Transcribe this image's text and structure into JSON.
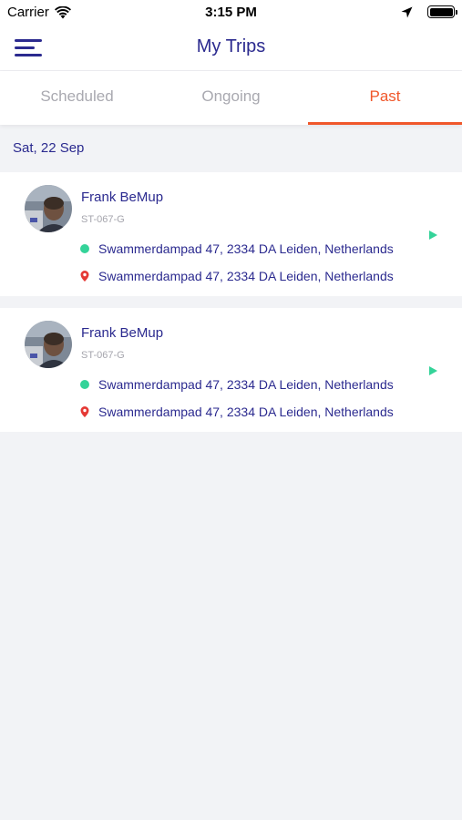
{
  "status_bar": {
    "carrier": "Carrier",
    "time": "3:15 PM",
    "icons": [
      "wifi-icon",
      "location-arrow-icon",
      "battery-icon"
    ]
  },
  "nav": {
    "title": "My Trips",
    "menu_icon": "hamburger-menu-icon"
  },
  "tabs": [
    {
      "label": "Scheduled",
      "active": false
    },
    {
      "label": "Ongoing",
      "active": false
    },
    {
      "label": "Past",
      "active": true
    }
  ],
  "date_header": "Sat, 22 Sep",
  "trips": [
    {
      "driver_name": "Frank BeMup",
      "plate": "ST-067-G",
      "pickup": "Swammerdampad 47, 2334 DA Leiden, Netherlands",
      "dropoff": "Swammerdampad 47, 2334 DA Leiden, Netherlands"
    },
    {
      "driver_name": "Frank BeMup",
      "plate": "ST-067-G",
      "pickup": "Swammerdampad 47, 2334 DA Leiden, Netherlands",
      "dropoff": "Swammerdampad 47, 2334 DA Leiden, Netherlands"
    }
  ],
  "colors": {
    "primary": "#2b2a8f",
    "accent": "#f0572a",
    "pickup_dot": "#34d399",
    "dropoff_pin": "#e53935",
    "background": "#f2f3f6"
  }
}
